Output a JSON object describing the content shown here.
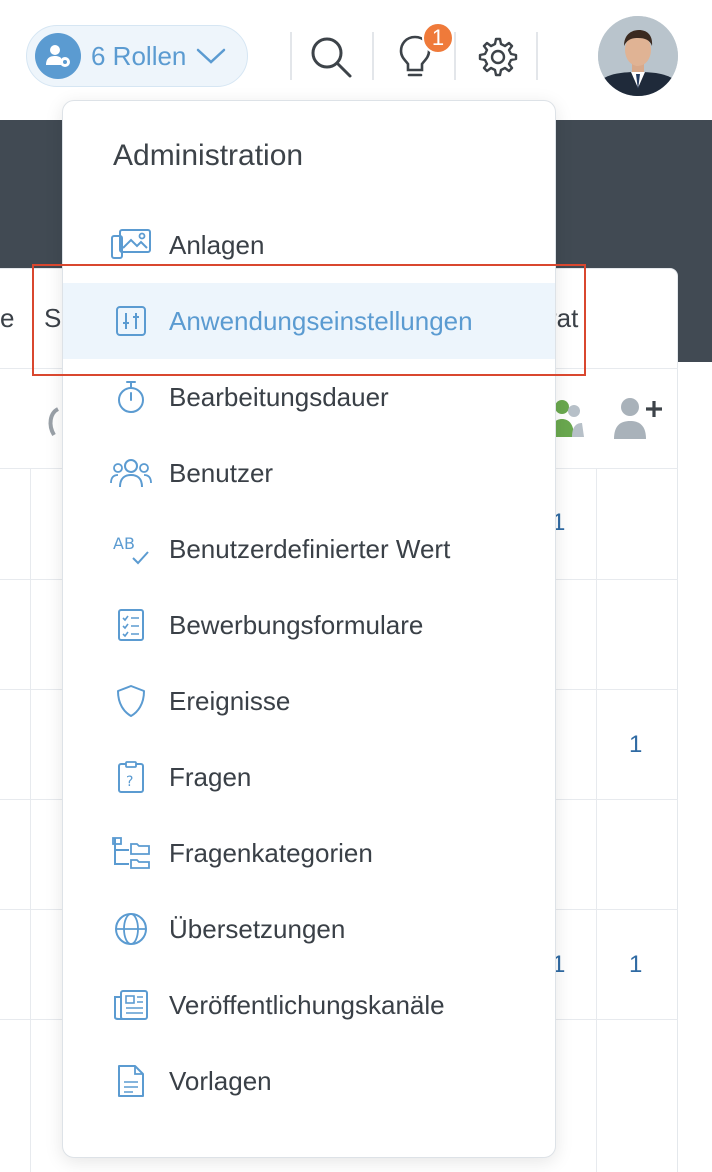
{
  "header": {
    "roles_label": "6 Rollen",
    "notification_count": "1",
    "icons": [
      "user-cog-icon",
      "chevron-down-icon",
      "search-icon",
      "lightbulb-icon",
      "gear-icon"
    ]
  },
  "table": {
    "header_fragments": {
      "left_a": "e",
      "left_b": "S",
      "right": "rat"
    },
    "cells": {
      "r1_c1": "1",
      "r3_c2": "1",
      "r5_c1": "1",
      "r5_c2": "1"
    }
  },
  "menu": {
    "title": "Administration",
    "items": [
      {
        "label": "Anlagen",
        "icon": "gallery-icon"
      },
      {
        "label": "Anwendungseinstellungen",
        "icon": "sliders-icon"
      },
      {
        "label": "Bearbeitungsdauer",
        "icon": "stopwatch-icon"
      },
      {
        "label": "Benutzer",
        "icon": "users-icon"
      },
      {
        "label": "Benutzerdefinierter Wert",
        "icon": "ab-check-icon"
      },
      {
        "label": "Bewerbungsformulare",
        "icon": "checklist-icon"
      },
      {
        "label": "Ereignisse",
        "icon": "shield-icon"
      },
      {
        "label": "Fragen",
        "icon": "question-clipboard-icon"
      },
      {
        "label": "Fragenkategorien",
        "icon": "folder-tree-icon"
      },
      {
        "label": "Übersetzungen",
        "icon": "globe-icon"
      },
      {
        "label": "Veröffentlichungskanäle",
        "icon": "newspaper-icon"
      },
      {
        "label": "Vorlagen",
        "icon": "document-icon"
      }
    ],
    "active_index": 1
  },
  "colors": {
    "accent": "#5b9bd1",
    "badge": "#ef7a3a",
    "dark_band": "#414a53",
    "highlight": "#d9472f"
  }
}
